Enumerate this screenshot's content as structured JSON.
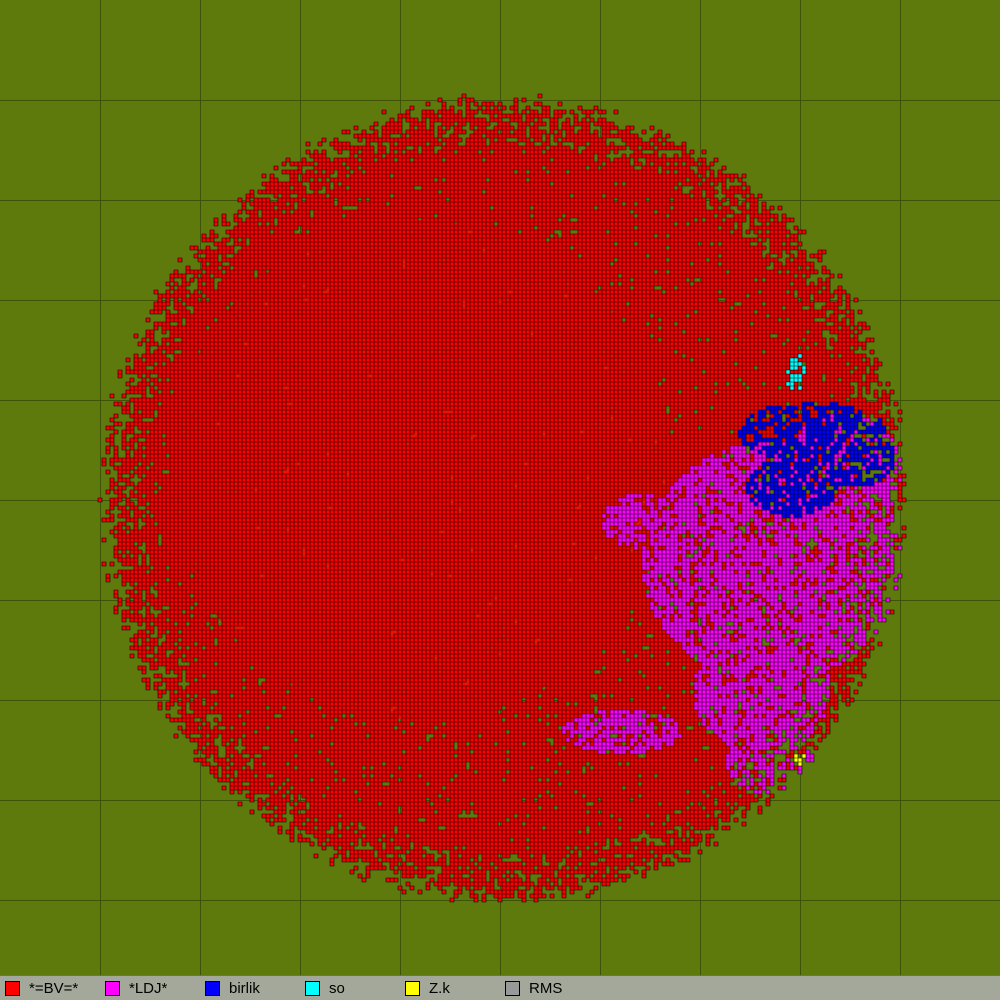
{
  "map": {
    "background_color": "#5f7a0c",
    "grid_color": "#3e5208",
    "cell_outline_color": "#000000"
  },
  "legend": {
    "items": [
      {
        "label": "*=BV=*",
        "color": "#ff0000"
      },
      {
        "label": "*LDJ*",
        "color": "#ff00ff"
      },
      {
        "label": "birlik",
        "color": "#0000ff"
      },
      {
        "label": "so",
        "color": "#00ffff"
      },
      {
        "label": "Z.k",
        "color": "#ffff00"
      },
      {
        "label": "RMS",
        "color": "#999999"
      }
    ]
  }
}
